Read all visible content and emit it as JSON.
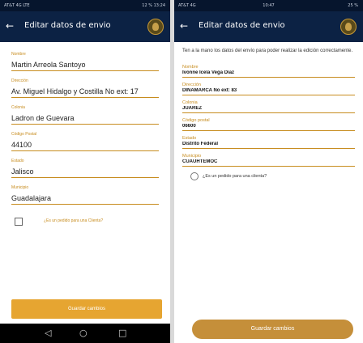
{
  "screenA": {
    "status": {
      "left": "AT&T 4G LTE",
      "center": "",
      "right": "12 % 13:24"
    },
    "appbar": {
      "back_glyph": "←",
      "title": "Editar datos de envio",
      "logo": "brand-logo"
    },
    "fields": [
      {
        "label": "Nombre",
        "value": "Martin Arreola Santoyo"
      },
      {
        "label": "Dirección",
        "value": "Av. Miguel Hidalgo y Costilla No ext: 17"
      },
      {
        "label": "Colonia",
        "value": "Ladron de Guevara"
      },
      {
        "label": "Código Postal",
        "value": "44100"
      },
      {
        "label": "Estado",
        "value": "Jalisco"
      },
      {
        "label": "Municipio",
        "value": "Guadalajara"
      }
    ],
    "checkbox_label": "¿Es un pedido para una Clienta?",
    "save_label": "Guardar cambios",
    "nav": {
      "back": "◁",
      "home": "○",
      "recent": "□"
    }
  },
  "screenB": {
    "status": {
      "left": "AT&T 4G",
      "center": "10:47",
      "right": "25 %"
    },
    "appbar": {
      "back_glyph": "←",
      "title": "Editar datos de envio",
      "logo": "brand-logo"
    },
    "intro": "Ten a la mano los datos del envío para poder realizar la edición correctamente.",
    "fields": [
      {
        "label": "Nombre",
        "value": "Ivonne Icela Vega Díaz"
      },
      {
        "label": "Dirección",
        "value": "DINAMARCA No ext: 83"
      },
      {
        "label": "Colonia",
        "value": "JUAREZ"
      },
      {
        "label": "Código postal",
        "value": "06600"
      },
      {
        "label": "Estado",
        "value": "Distrito Federal"
      },
      {
        "label": "Municipio",
        "value": "CUAUHTEMOC"
      }
    ],
    "radio_label": "¿Es un pedido para una clienta?",
    "save_label": "Guardar cambios"
  },
  "colors": {
    "appbar": "#0c2244",
    "accent": "#c78c1e",
    "buttonA": "#e6a531",
    "buttonB": "#c58f3a"
  }
}
